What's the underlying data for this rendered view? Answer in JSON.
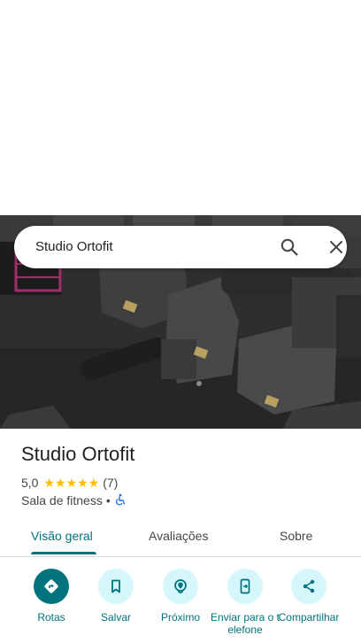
{
  "search": {
    "query": "Studio Ortofit"
  },
  "place": {
    "name": "Studio Ortofit",
    "rating": "5,0",
    "stars": "★★★★★",
    "review_count": "(7)",
    "category": "Sala de fitness",
    "separator": "•",
    "accessibility_icon": "wheelchair-icon"
  },
  "tabs": [
    {
      "label": "Visão geral",
      "active": true
    },
    {
      "label": "Avaliações",
      "active": false
    },
    {
      "label": "Sobre",
      "active": false
    }
  ],
  "actions": [
    {
      "label": "Rotas",
      "icon": "directions-icon"
    },
    {
      "label": "Salvar",
      "icon": "bookmark-icon"
    },
    {
      "label": "Próximo",
      "icon": "nearby-icon"
    },
    {
      "label": "Enviar para o telefone",
      "icon": "send-to-phone-icon"
    },
    {
      "label": "Compartilhar",
      "icon": "share-icon"
    }
  ],
  "colors": {
    "accent": "#00737c",
    "accent_light": "#d5f6fb",
    "star": "#fbbc04"
  }
}
